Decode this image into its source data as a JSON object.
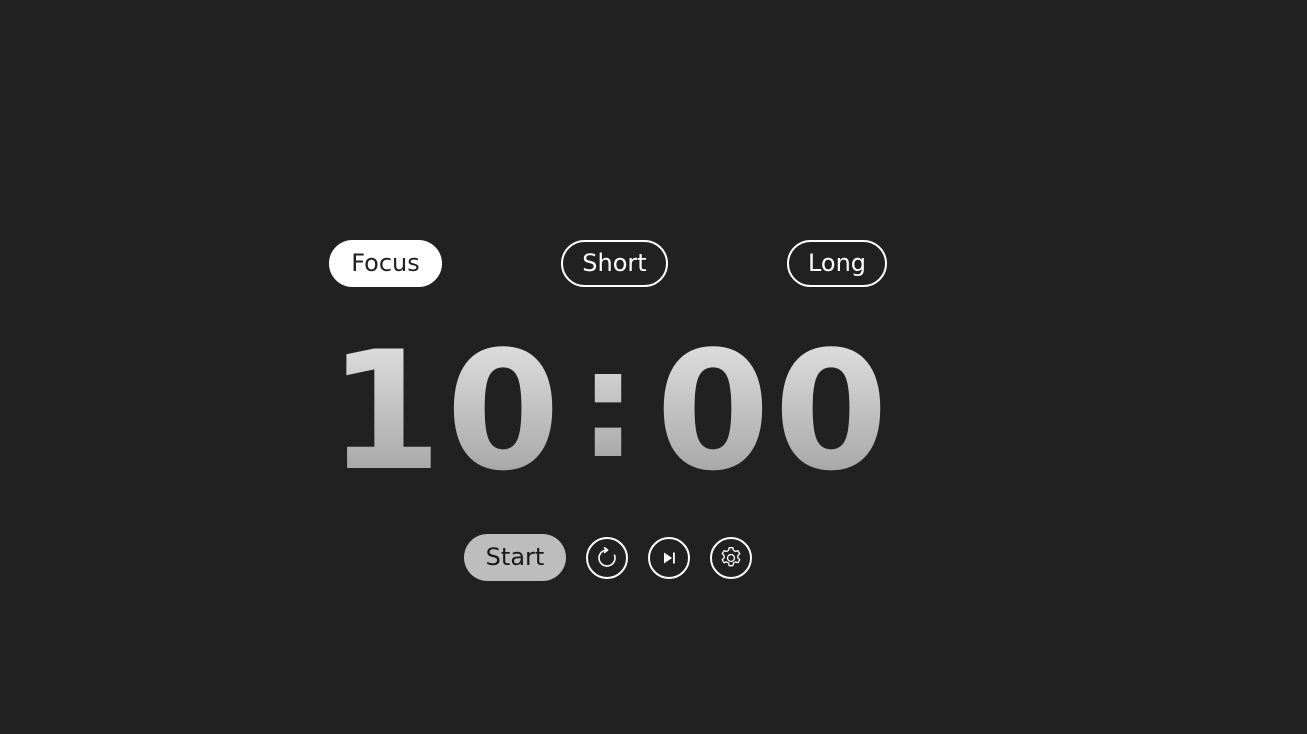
{
  "modes": {
    "focus_label": "Focus",
    "short_label": "Short",
    "long_label": "Long",
    "active": "focus"
  },
  "timer": {
    "minutes": "10",
    "separator": ":",
    "seconds": "00",
    "gradient_top": "#e8e8e8",
    "gradient_bottom": "#9a9a9a"
  },
  "controls": {
    "start_label": "Start",
    "reset_icon": "reset-icon",
    "skip_icon": "skip-forward-icon",
    "settings_icon": "gear-icon"
  },
  "colors": {
    "background": "#212121",
    "foreground": "#ffffff",
    "start_button": "#bdbdbd"
  }
}
